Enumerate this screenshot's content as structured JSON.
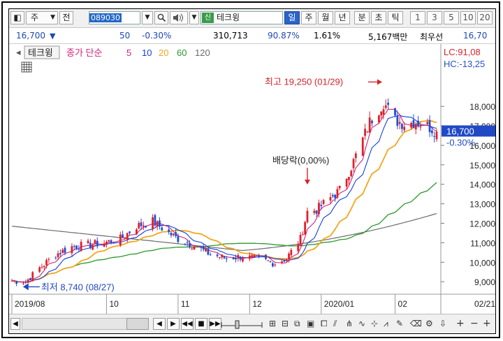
{
  "toolbar": {
    "type_label": "주",
    "jeon_label": "전",
    "stock_code": "089030",
    "stock_name": "테크윙",
    "shin_badge": "신",
    "periods": [
      "일",
      "주",
      "월",
      "년",
      "분",
      "초",
      "틱"
    ],
    "active_period": "일",
    "numbers": [
      "1",
      "3",
      "5",
      "10",
      "20"
    ]
  },
  "quote": {
    "price": "16,700",
    "change_arrow": "▼",
    "change": "50",
    "change_pct": "-0.30%",
    "volume": "310,713",
    "ratio1": "90.87%",
    "ratio2": "1.61%",
    "amount": "5,167백만",
    "tag": "최우선",
    "tail_price": "16,70"
  },
  "chart_data": {
    "type": "line",
    "legend": {
      "name": "테크윙",
      "ma_label": "종가 단순",
      "ma_periods": [
        "5",
        "10",
        "20",
        "60",
        "120"
      ],
      "ma_colors": [
        "#d0247f",
        "#1540d8",
        "#f2a620",
        "#2a9a2a",
        "#6b6b6b"
      ]
    },
    "y_ticks": [
      "18,000",
      "17,000",
      "16,000",
      "15,000",
      "14,000",
      "13,000",
      "12,000",
      "11,000",
      "10,000",
      "9,000"
    ],
    "ylim": [
      8360,
      19980
    ],
    "x_ticks": [
      "2019/08",
      "10",
      "11",
      "12",
      "2020/01",
      "02",
      "02/21"
    ],
    "xlim": [
      "2019-08-21",
      "2020-02-21"
    ],
    "lc": "LC:91,08",
    "hc": "HC:-13,25",
    "current_price": "16,700",
    "current_pct": "-0.30%",
    "annotations": {
      "high": "최고 19,250 (01/29)",
      "low": "최저 8,740 (08/27)",
      "dividend": "배당락(0,00%)"
    },
    "high_value": 19250,
    "low_value": 8740,
    "close_anchors": [
      {
        "x": "2019-08-21",
        "y": 9050
      },
      {
        "x": "2019-08-27",
        "y": 9000
      },
      {
        "x": "2019-09-02",
        "y": 9700
      },
      {
        "x": "2019-09-09",
        "y": 10400
      },
      {
        "x": "2019-09-16",
        "y": 10800
      },
      {
        "x": "2019-09-23",
        "y": 10900
      },
      {
        "x": "2019-09-30",
        "y": 11000
      },
      {
        "x": "2019-10-07",
        "y": 11200
      },
      {
        "x": "2019-10-14",
        "y": 11850
      },
      {
        "x": "2019-10-21",
        "y": 12100
      },
      {
        "x": "2019-10-28",
        "y": 11500
      },
      {
        "x": "2019-11-01",
        "y": 11200
      },
      {
        "x": "2019-11-08",
        "y": 10850
      },
      {
        "x": "2019-11-15",
        "y": 10400
      },
      {
        "x": "2019-11-22",
        "y": 10200
      },
      {
        "x": "2019-11-29",
        "y": 10300
      },
      {
        "x": "2019-12-06",
        "y": 10150
      },
      {
        "x": "2019-12-13",
        "y": 9950
      },
      {
        "x": "2019-12-18",
        "y": 10200
      },
      {
        "x": "2019-12-24",
        "y": 11200
      },
      {
        "x": "2019-12-27",
        "y": 12600
      },
      {
        "x": "2019-12-31",
        "y": 12700
      },
      {
        "x": "2020-01-06",
        "y": 13300
      },
      {
        "x": "2020-01-10",
        "y": 13700
      },
      {
        "x": "2020-01-15",
        "y": 14900
      },
      {
        "x": "2020-01-20",
        "y": 16300
      },
      {
        "x": "2020-01-23",
        "y": 17200
      },
      {
        "x": "2020-01-29",
        "y": 18200
      },
      {
        "x": "2020-02-03",
        "y": 17300
      },
      {
        "x": "2020-02-07",
        "y": 17100
      },
      {
        "x": "2020-02-12",
        "y": 17200
      },
      {
        "x": "2020-02-17",
        "y": 17000
      },
      {
        "x": "2020-02-21",
        "y": 16700
      }
    ],
    "ma120_endpoints": [
      {
        "x": "2019-08-21",
        "y": 11850
      },
      {
        "x": "2019-11-29",
        "y": 10600
      },
      {
        "x": "2020-02-21",
        "y": 12500
      }
    ]
  },
  "bottom": {
    "nav_buttons": [
      "◀",
      "▶",
      "◀◀",
      "■",
      "▶▶"
    ],
    "plus": "+",
    "minus": "−",
    "plus2": "+"
  }
}
